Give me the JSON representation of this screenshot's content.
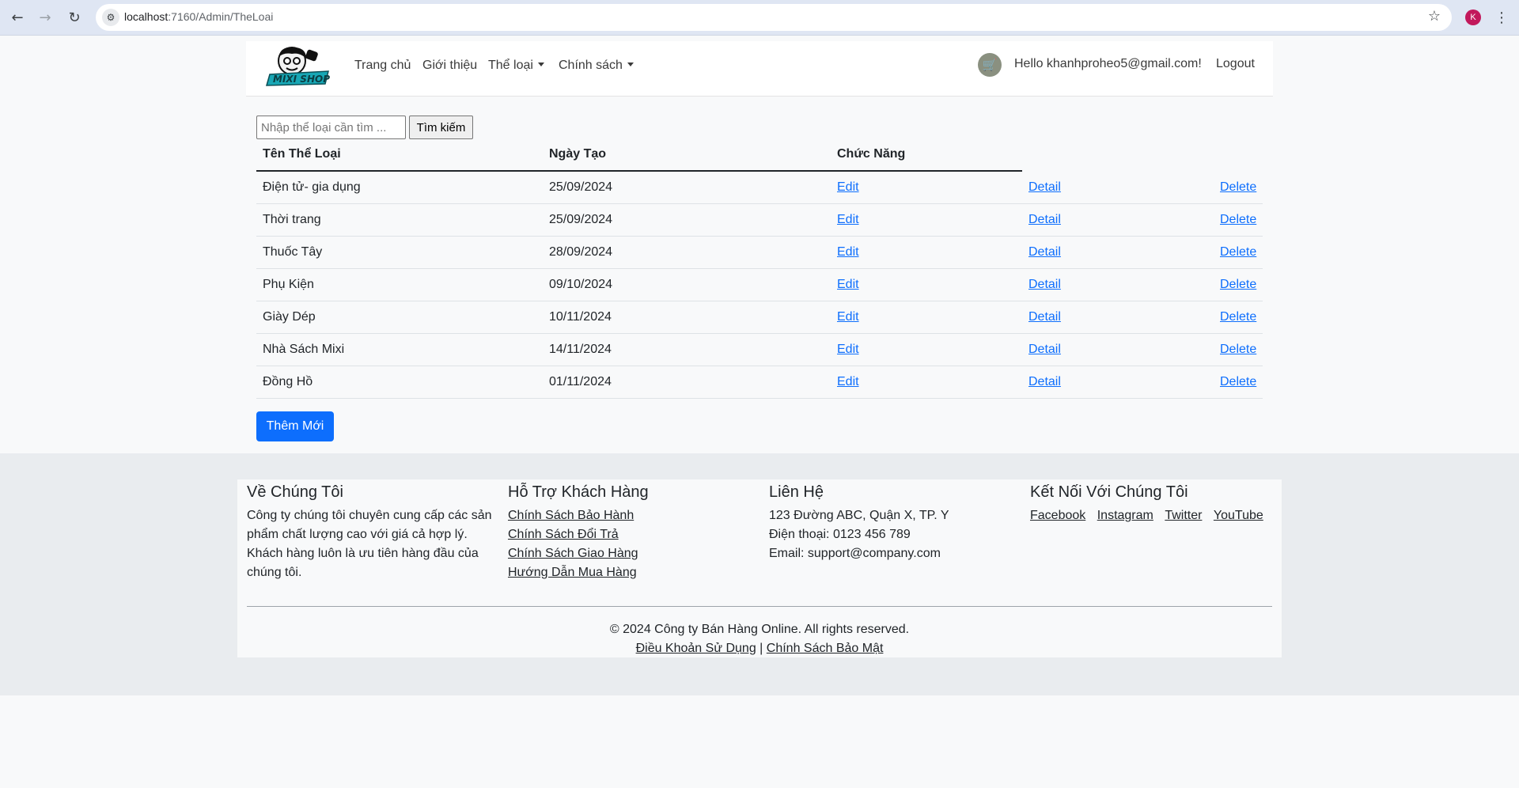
{
  "browser": {
    "url_host": "localhost",
    "url_path": ":7160/Admin/TheLoai",
    "profile_initial": "K",
    "icons": {
      "back": "arrow-left-icon",
      "forward": "arrow-right-icon",
      "reload": "reload-icon",
      "site_info": "site-settings-icon",
      "bookmark": "star-icon",
      "menu": "kebab-menu-icon"
    }
  },
  "navbar": {
    "logo_alt": "MIXI SHOP",
    "links": [
      "Trang chủ",
      "Giới thiệu",
      "Thể loại",
      "Chính sách"
    ],
    "greeting": "Hello khanhproheo5@gmail.com!",
    "logout": "Logout",
    "cart_icon": "cart-icon"
  },
  "search": {
    "placeholder": "Nhập thể loại cần tìm ...",
    "button": "Tìm kiếm"
  },
  "table": {
    "headers": [
      "Tên Thể Loại",
      "Ngày Tạo",
      "Chức Năng"
    ],
    "actions": [
      "Edit",
      "Detail",
      "Delete"
    ],
    "rows": [
      {
        "name": "Điện tử- gia dụng",
        "date": "25/09/2024"
      },
      {
        "name": "Thời trang",
        "date": "25/09/2024"
      },
      {
        "name": "Thuốc Tây",
        "date": "28/09/2024"
      },
      {
        "name": "Phụ Kiện",
        "date": "09/10/2024"
      },
      {
        "name": "Giày Dép",
        "date": "10/11/2024"
      },
      {
        "name": "Nhà Sách Mixi",
        "date": "14/11/2024"
      },
      {
        "name": "Đồng Hồ",
        "date": "01/11/2024"
      }
    ]
  },
  "add_button": "Thêm Mới",
  "footer": {
    "about": {
      "title": "Về Chúng Tôi",
      "text": "Công ty chúng tôi chuyên cung cấp các sản phẩm chất lượng cao với giá cả hợp lý. Khách hàng luôn là ưu tiên hàng đầu của chúng tôi."
    },
    "support": {
      "title": "Hỗ Trợ Khách Hàng",
      "links": [
        "Chính Sách Bảo Hành",
        "Chính Sách Đổi Trả",
        "Chính Sách Giao Hàng",
        "Hướng Dẫn Mua Hàng"
      ]
    },
    "contact": {
      "title": "Liên Hệ",
      "address": "123 Đường ABC, Quận X, TP. Y",
      "phone": "Điện thoại: 0123 456 789",
      "email": "Email: support@company.com"
    },
    "social": {
      "title": "Kết Nối Với Chúng Tôi",
      "links": [
        "Facebook",
        "Instagram",
        "Twitter",
        "YouTube"
      ]
    },
    "copyright": "© 2024 Công ty Bán Hàng Online. All rights reserved.",
    "terms": "Điều Khoản Sử Dụng",
    "separator": "|",
    "privacy": "Chính Sách Bảo Mật"
  }
}
